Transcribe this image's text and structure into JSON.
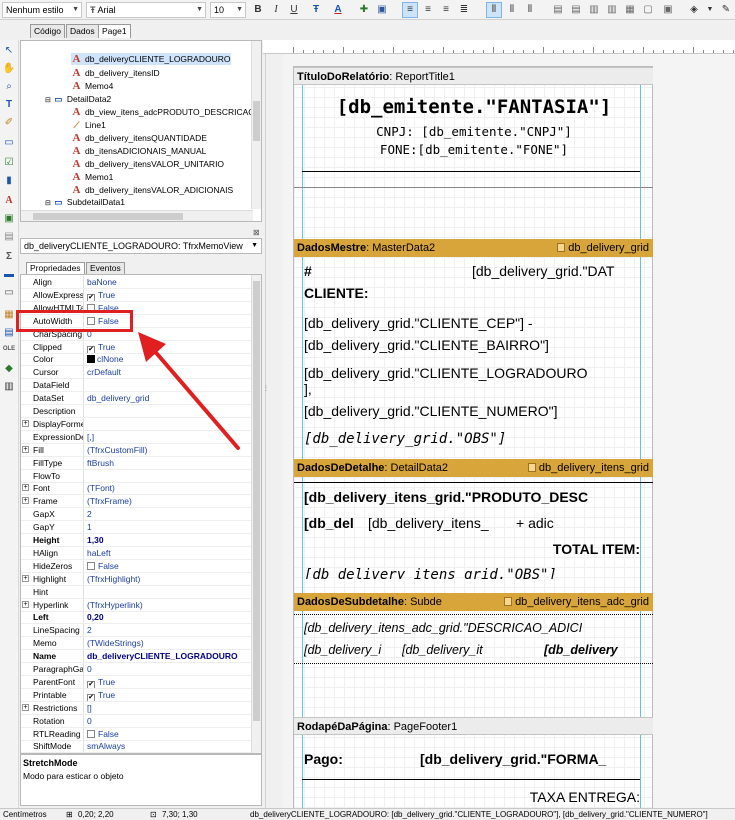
{
  "toolbar": {
    "style_combo": "Nenhum estilo",
    "font_combo": "Arial",
    "font_size": "10",
    "buttons": [
      "B",
      "I",
      "U"
    ]
  },
  "doc_tabs": [
    "Código",
    "Dados",
    "Page1"
  ],
  "tree": {
    "items": [
      {
        "label": "db_deliveryCLIENTE_LOGRADOURO",
        "icon": "memo-icon",
        "selected": true
      },
      {
        "label": "db_delivery_itensID",
        "icon": "memo-icon"
      },
      {
        "label": "Memo4",
        "icon": "memo-icon"
      },
      {
        "label": "DetailData2",
        "icon": "band-icon"
      },
      {
        "label": "db_view_itens_adcPRODUTO_DESCRICAO",
        "icon": "memo-icon"
      },
      {
        "label": "Line1",
        "icon": "line-icon"
      },
      {
        "label": "db_delivery_itensQUANTIDADE",
        "icon": "memo-icon"
      },
      {
        "label": "db_itensADICIONAIS_MANUAL",
        "icon": "memo-icon"
      },
      {
        "label": "db_delivery_itensVALOR_UNITARIO",
        "icon": "memo-icon"
      },
      {
        "label": "Memo1",
        "icon": "memo-icon"
      },
      {
        "label": "db_delivery_itensVALOR_ADICIONAIS",
        "icon": "memo-icon"
      },
      {
        "label": "SubdetailData1",
        "icon": "band-icon"
      }
    ]
  },
  "object_combo": "db_deliveryCLIENTE_LOGRADOURO: TfrxMemoView",
  "inspector_tabs": [
    "Propriedades",
    "Eventos"
  ],
  "properties": [
    {
      "name": "Align",
      "value": "baNone"
    },
    {
      "name": "AllowExpress",
      "value": "True",
      "check": true
    },
    {
      "name": "AllowHTMLTa",
      "value": "False",
      "check": false
    },
    {
      "name": "AutoWidth",
      "value": "False",
      "check": false
    },
    {
      "name": "CharSpacing",
      "value": "0"
    },
    {
      "name": "Clipped",
      "value": "True",
      "check": true
    },
    {
      "name": "Color",
      "value": "clNone",
      "swatch": "#000000"
    },
    {
      "name": "Cursor",
      "value": "crDefault"
    },
    {
      "name": "DataField",
      "value": ""
    },
    {
      "name": "DataSet",
      "value": "db_delivery_grid"
    },
    {
      "name": "Description",
      "value": ""
    },
    {
      "name": "DisplayForme",
      "value": "",
      "expand": true
    },
    {
      "name": "ExpressionDe",
      "value": "[,]"
    },
    {
      "name": "Fill",
      "value": "(TfrxCustomFill)",
      "expand": true
    },
    {
      "name": "FillType",
      "value": "ftBrush"
    },
    {
      "name": "FlowTo",
      "value": ""
    },
    {
      "name": "Font",
      "value": "(TFont)",
      "expand": true
    },
    {
      "name": "Frame",
      "value": "(TfrxFrame)",
      "expand": true
    },
    {
      "name": "GapX",
      "value": "2"
    },
    {
      "name": "GapY",
      "value": "1"
    },
    {
      "name": "Height",
      "value": "1,30",
      "bold": true
    },
    {
      "name": "HAlign",
      "value": "haLeft"
    },
    {
      "name": "HideZeros",
      "value": "False",
      "check": false
    },
    {
      "name": "Highlight",
      "value": "(TfrxHighlight)",
      "expand": true
    },
    {
      "name": "Hint",
      "value": ""
    },
    {
      "name": "Hyperlink",
      "value": "(TfrxHyperlink)",
      "expand": true
    },
    {
      "name": "Left",
      "value": "0,20",
      "bold": true
    },
    {
      "name": "LineSpacing",
      "value": "2"
    },
    {
      "name": "Memo",
      "value": "(TWideStrings)"
    },
    {
      "name": "Name",
      "value": "db_deliveryCLIENTE_LOGRADOURO",
      "bold": true
    },
    {
      "name": "ParagraphGa",
      "value": "0"
    },
    {
      "name": "ParentFont",
      "value": "True",
      "check": true
    },
    {
      "name": "Printable",
      "value": "True",
      "check": true
    },
    {
      "name": "Restrictions",
      "value": "[]",
      "expand": true
    },
    {
      "name": "Rotation",
      "value": "0"
    },
    {
      "name": "RTLReading",
      "value": "False",
      "check": false
    },
    {
      "name": "ShiftMode",
      "value": "smAlways"
    }
  ],
  "hint": {
    "title": "StretchMode",
    "description": "Modo para esticar o objeto"
  },
  "report": {
    "title_band": {
      "name": "TítuloDoRelatório",
      "component": "ReportTitle1"
    },
    "fantasia": "[db_emitente.\"FANTASIA\"]",
    "cnpj": "CNPJ: [db_emitente.\"CNPJ\"]",
    "fone": "FONE:[db_emitente.\"FONE\"]",
    "master_band": {
      "name": "DadosMestre",
      "component": "MasterData2",
      "dataset": "db_delivery_grid"
    },
    "hash": "#",
    "dat": "[db_delivery_grid.\"DAT",
    "cliente": "CLIENTE:",
    "cep": "[db_delivery_grid.\"CLIENTE_CEP\"] -",
    "bairro": "[db_delivery_grid.\"CLIENTE_BAIRRO\"]",
    "logradouro": "[db_delivery_grid.\"CLIENTE_LOGRADOURO",
    "comma": "],",
    "numero": "[db_delivery_grid.\"CLIENTE_NUMERO\"]",
    "obs": "[db_delivery_grid.\"OBS\"]",
    "detail_band": {
      "name": "DadosDeDetalhe",
      "component": "DetailData2",
      "dataset": "db_delivery_itens_grid"
    },
    "produto": "[db_delivery_itens_grid.\"PRODUTO_DESC",
    "db_del": "[db_del",
    "itens_short": "[db_delivery_itens_",
    "adic": "+ adic",
    "total_item": "TOTAL ITEM:",
    "itens_obs": "[db_delivery_itens_grid.\"OBS\"]",
    "subdetail_band": {
      "name": "DadosDeSubdetalhe",
      "component": "Subde",
      "dataset": "db_delivery_itens_adc_grid"
    },
    "desc_adici": "[db_delivery_itens_adc_grid.\"DESCRICAO_ADICI",
    "sub_a": "[db_delivery_i",
    "sub_b": "[db_delivery_it",
    "sub_c": "[db_delivery",
    "footer_band": {
      "name": "RodapéDaPágina",
      "component": "PageFooter1"
    },
    "pago": "Pago:",
    "forma": "[db_delivery_grid.\"FORMA_",
    "taxa": "TAXA ENTREGA:"
  },
  "status": {
    "units": "Centímetros",
    "pos": "0,20; 2,20",
    "size": "7,30; 1,30",
    "text": "db_deliveryCLIENTE_LOGRADOURO: [db_delivery_grid.\"CLIENTE_LOGRADOURO\"], [db_delivery_grid.\"CLIENTE_NUMERO\"]"
  }
}
